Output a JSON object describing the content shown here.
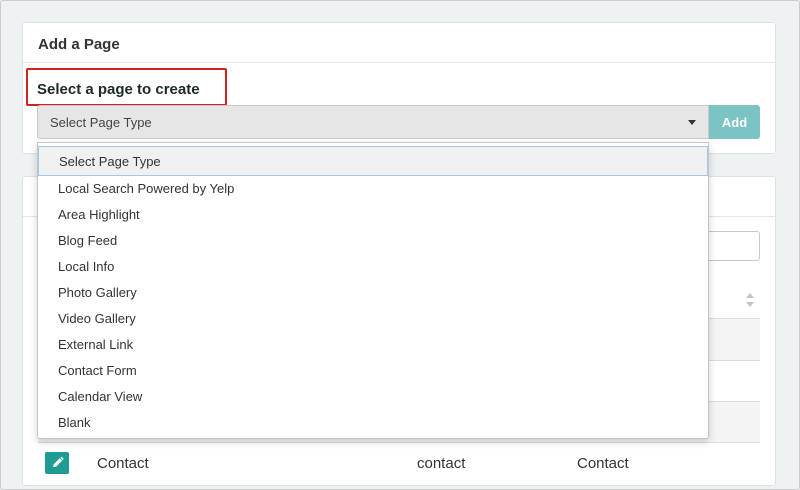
{
  "add_page_card": {
    "title": "Add a Page",
    "select_label": "Select a page to create",
    "select_value": "Select Page Type",
    "add_button": "Add"
  },
  "dropdown": {
    "options": [
      "Select Page Type",
      "Local Search Powered by Yelp",
      "Area Highlight",
      "Blog Feed",
      "Local Info",
      "Photo Gallery",
      "Video Gallery",
      "External Link",
      "Contact Form",
      "Calendar View",
      "Blank"
    ],
    "selected_index": 0
  },
  "pages_table": {
    "visible_row": {
      "title": "Contact",
      "slug": "contact",
      "type": "Contact"
    }
  },
  "icons": {
    "edit": "pencil-icon",
    "sort": "sort-icon",
    "caret": "chevron-down-icon"
  },
  "colors": {
    "highlight": "#d41f1f",
    "add_button": "#7cc4c4",
    "edit_button": "#1e9c93"
  }
}
